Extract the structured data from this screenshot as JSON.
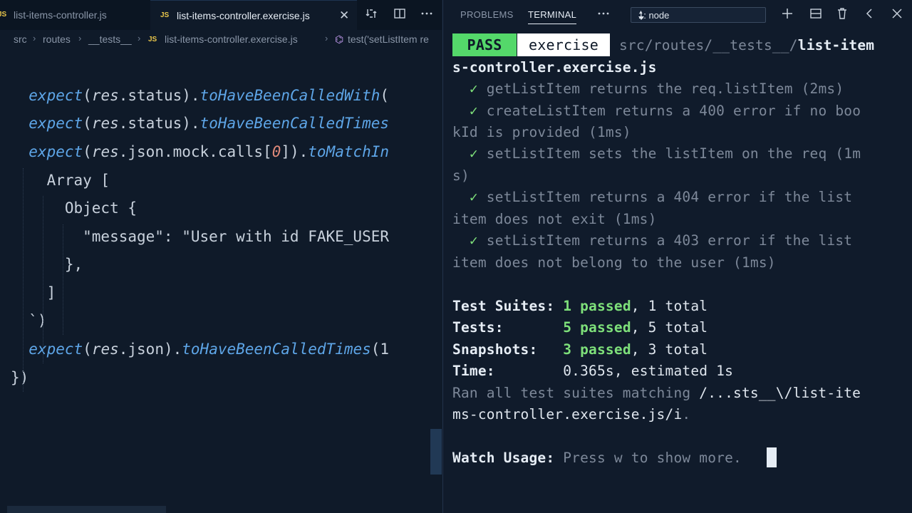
{
  "editor": {
    "tabs": [
      {
        "label": "list-items-controller.js",
        "badge": "JS"
      },
      {
        "label": "list-items-controller.exercise.js",
        "badge": "JS",
        "close": "✕"
      }
    ],
    "breadcrumb": {
      "parts": [
        "src",
        "routes",
        "__tests__",
        "list-items-controller.exercise.js",
        "test('setListItem re"
      ],
      "file_badge": "JS"
    },
    "code_lines": {
      "l1": {
        "a": "  expect",
        "b": "(",
        "c": "res",
        "d": ".status).",
        "e": "toHaveBeenCalledWith",
        "f": "("
      },
      "l2": {
        "a": "  expect",
        "b": "(",
        "c": "res",
        "d": ".status).",
        "e": "toHaveBeenCalledTimes"
      },
      "l3": {
        "a": "  expect",
        "b": "(",
        "c": "res",
        "d": ".json.mock.calls[",
        "n": "0",
        "g": "]).",
        "e": "toMatchIn"
      },
      "l4": "    Array [",
      "l5": "      Object {",
      "l6": "        \"message\": \"User with id FAKE_USER",
      "l7": "      },",
      "l8": "    ]",
      "l9": "  `)",
      "l10": {
        "a": "  expect",
        "b": "(",
        "c": "res",
        "d": ".json).",
        "e": "toHaveBeenCalledTimes",
        "f": "(1"
      },
      "l11": "})"
    }
  },
  "panel": {
    "tabs": [
      "PROBLEMS",
      "TERMINAL"
    ],
    "active_tab": "TERMINAL",
    "terminal_select": "1: node",
    "icons": [
      "more-icon",
      "add-icon",
      "split-icon",
      "trash-icon",
      "chevron-left-icon",
      "close-icon"
    ]
  },
  "terminal": {
    "pass_badge": "PASS",
    "file_badge": "exercise",
    "path_dim": "src/routes/__tests__/",
    "path_bold": "list-item",
    "path_bold2": "s-controller.exercise.js",
    "tests": [
      {
        "check": "✓",
        "line1": "getListItem returns the req.listItem (2ms)",
        "line2": ""
      },
      {
        "check": "✓",
        "line1": "createListItem returns a 400 error if no boo",
        "line2": "kId is provided (1ms)"
      },
      {
        "check": "✓",
        "line1": "setListItem sets the listItem on the req (1m",
        "line2": "s)"
      },
      {
        "check": "✓",
        "line1": "setListItem returns a 404 error if the list",
        "line2": "item does not exit (1ms)"
      },
      {
        "check": "✓",
        "line1": "setListItem returns a 403 error if the list",
        "line2": "item does not belong to the user (1ms)"
      }
    ],
    "summary": {
      "suites_label": "Test Suites: ",
      "suites_passed": "1 passed",
      "suites_total": ", 1 total",
      "tests_label": "Tests:       ",
      "tests_passed": "5 passed",
      "tests_total": ", 5 total",
      "snap_label": "Snapshots:   ",
      "snap_passed": "3 passed",
      "snap_total": ", 3 total",
      "time_label": "Time:        ",
      "time_value": "0.365s, estimated 1s"
    },
    "ran_dim": "Ran all test suites matching ",
    "ran_pattern1": "/...sts__\\/list-ite",
    "ran_pattern2": "ms-controller.exercise.js/i",
    "ran_end": ".",
    "watch_label": "Watch Usage: ",
    "watch_text": "Press w to show more."
  }
}
